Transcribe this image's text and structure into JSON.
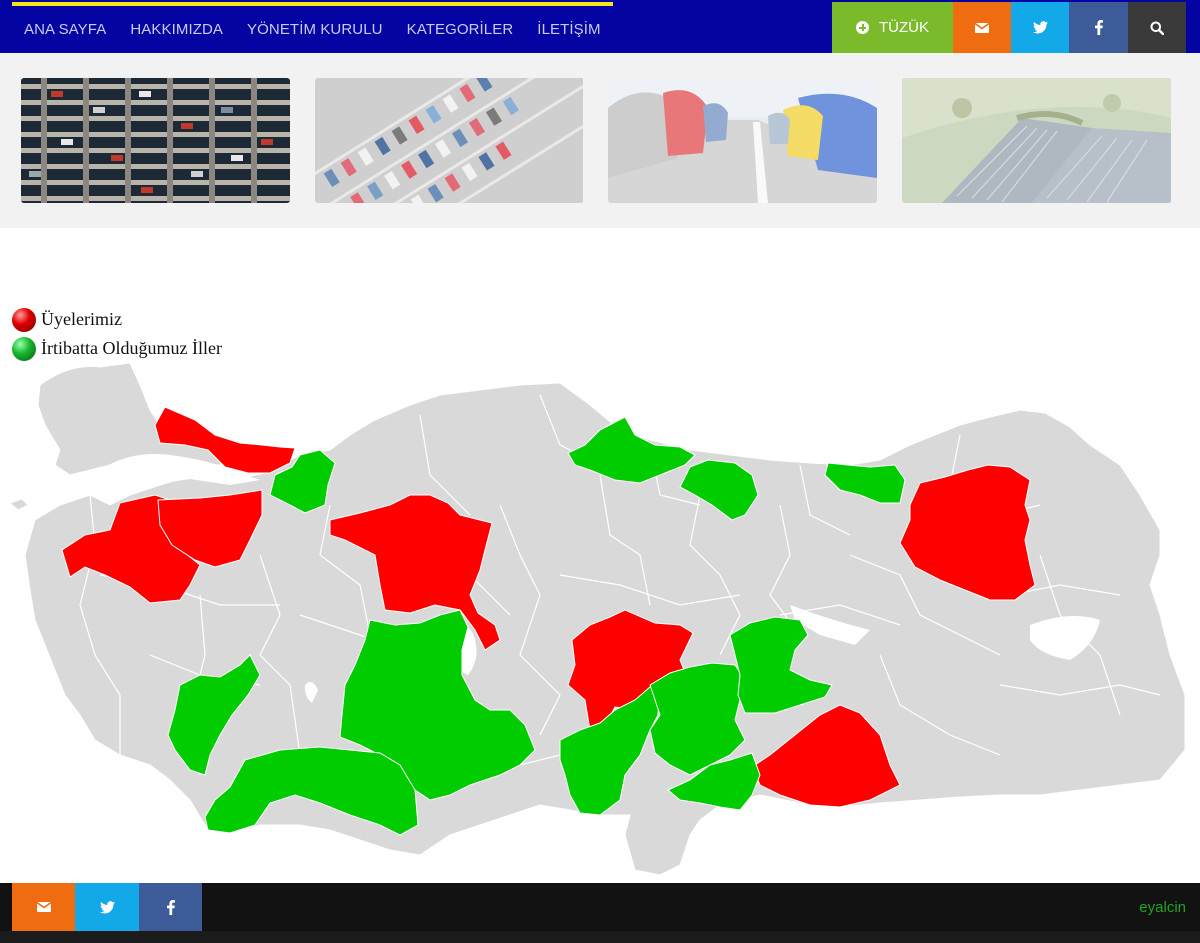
{
  "nav": {
    "menu": [
      "ANA SAYFA",
      "HAKKIMIZDA",
      "YÖNETİM KURULU",
      "KATEGORİLER",
      "İLETİŞİM"
    ],
    "tuzuk_label": "TÜZÜK"
  },
  "icons": {
    "mail": "envelope-icon",
    "twitter": "twitter-bird-icon",
    "facebook": "facebook-f-icon",
    "search": "magnifier-icon"
  },
  "photos": [
    {
      "name": "multi-storey-car-park"
    },
    {
      "name": "parking-lot-aerial"
    },
    {
      "name": "parked-cars-row"
    },
    {
      "name": "solar-panel-field-aerial"
    }
  ],
  "legend": {
    "members": "Üyelerimiz",
    "contacts": "İrtibatta Olduğumuz İller"
  },
  "colors": {
    "nav_bg": "#0404a2",
    "member": "#ff0000",
    "contact": "#00cc00",
    "province": "#d9d9d9",
    "tuzuk": "#7bba2a",
    "mail": "#ef6c11",
    "twitter": "#13a8e8",
    "facebook": "#3d5b98"
  },
  "footer": {
    "credit": "eyalcin"
  }
}
